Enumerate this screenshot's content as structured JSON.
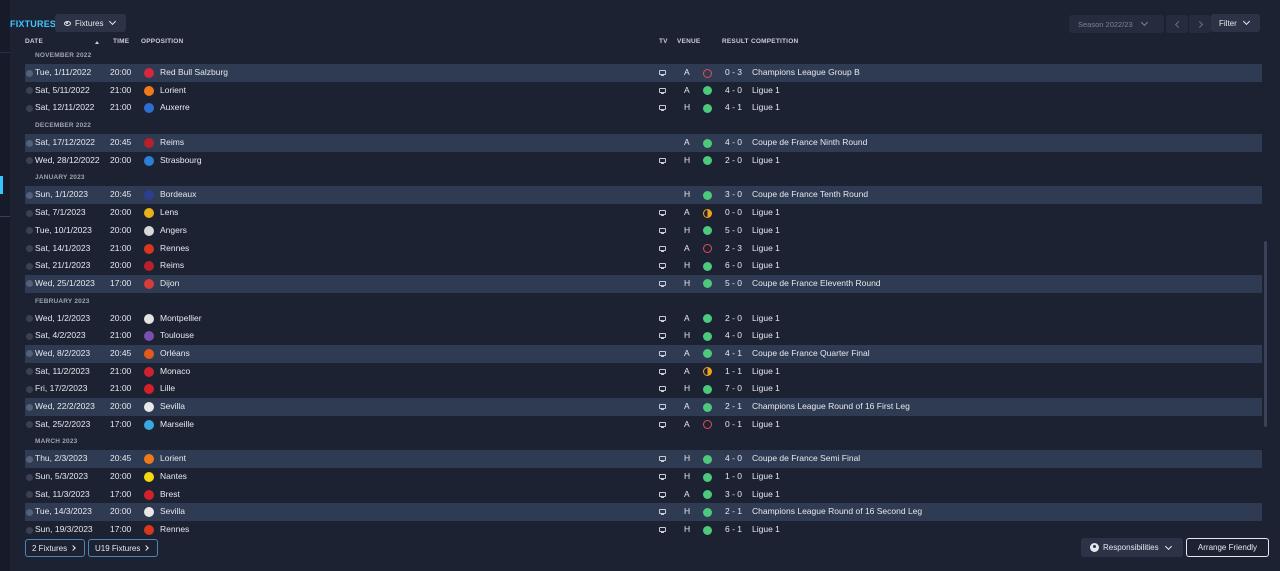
{
  "header": {
    "title": "FIXTURES",
    "view_dropdown": "Fixtures",
    "season": "Season 2022/23",
    "filter": "Filter"
  },
  "columns": {
    "date": "DATE",
    "time": "TIME",
    "opposition": "OPPOSITION",
    "tv": "TV",
    "venue": "VENUE",
    "result": "RESULT",
    "competition": "COMPETITION"
  },
  "months": [
    {
      "label": "NOVEMBER 2022",
      "fixtures": [
        {
          "date": "Tue, 1/11/2022",
          "time": "20:00",
          "opp": "Red Bull Salzburg",
          "badge": "#d7263d",
          "tv": true,
          "venue": "A",
          "outcome": "L",
          "result": "0 - 3",
          "comp": "Champions League Group B",
          "hl": true
        },
        {
          "date": "Sat, 5/11/2022",
          "time": "21:00",
          "opp": "Lorient",
          "badge": "#f07a1a",
          "tv": true,
          "venue": "A",
          "outcome": "W",
          "result": "4 - 0",
          "comp": "Ligue 1",
          "hl": false
        },
        {
          "date": "Sat, 12/11/2022",
          "time": "21:00",
          "opp": "Auxerre",
          "badge": "#2c6fd1",
          "tv": true,
          "venue": "H",
          "outcome": "W",
          "result": "4 - 1",
          "comp": "Ligue 1",
          "hl": false
        }
      ]
    },
    {
      "label": "DECEMBER 2022",
      "fixtures": [
        {
          "date": "Sat, 17/12/2022",
          "time": "20:45",
          "opp": "Reims",
          "badge": "#b8202c",
          "tv": false,
          "venue": "A",
          "outcome": "W",
          "result": "4 - 0",
          "comp": "Coupe de France Ninth Round",
          "hl": true
        },
        {
          "date": "Wed, 28/12/2022",
          "time": "20:00",
          "opp": "Strasbourg",
          "badge": "#2d7fd6",
          "tv": true,
          "venue": "H",
          "outcome": "W",
          "result": "2 - 0",
          "comp": "Ligue 1",
          "hl": false
        }
      ]
    },
    {
      "label": "JANUARY 2023",
      "fixtures": [
        {
          "date": "Sun, 1/1/2023",
          "time": "20:45",
          "opp": "Bordeaux",
          "badge": "#2a3f8f",
          "tv": false,
          "venue": "H",
          "outcome": "W",
          "result": "3 - 0",
          "comp": "Coupe de France Tenth Round",
          "hl": true
        },
        {
          "date": "Sat, 7/1/2023",
          "time": "20:00",
          "opp": "Lens",
          "badge": "#e6b21c",
          "tv": true,
          "venue": "A",
          "outcome": "D",
          "result": "0 - 0",
          "comp": "Ligue 1",
          "hl": false
        },
        {
          "date": "Tue, 10/1/2023",
          "time": "20:00",
          "opp": "Angers",
          "badge": "#d8d8d8",
          "tv": true,
          "venue": "H",
          "outcome": "W",
          "result": "5 - 0",
          "comp": "Ligue 1",
          "hl": false
        },
        {
          "date": "Sat, 14/1/2023",
          "time": "21:00",
          "opp": "Rennes",
          "badge": "#d9361f",
          "tv": true,
          "venue": "A",
          "outcome": "L",
          "result": "2 - 3",
          "comp": "Ligue 1",
          "hl": false
        },
        {
          "date": "Sat, 21/1/2023",
          "time": "20:00",
          "opp": "Reims",
          "badge": "#b8202c",
          "tv": true,
          "venue": "H",
          "outcome": "W",
          "result": "6 - 0",
          "comp": "Ligue 1",
          "hl": false
        },
        {
          "date": "Wed, 25/1/2023",
          "time": "17:00",
          "opp": "Dijon",
          "badge": "#d83b3b",
          "tv": true,
          "venue": "H",
          "outcome": "W",
          "result": "5 - 0",
          "comp": "Coupe de France Eleventh Round",
          "hl": true
        }
      ]
    },
    {
      "label": "FEBRUARY 2023",
      "fixtures": [
        {
          "date": "Wed, 1/2/2023",
          "time": "20:00",
          "opp": "Montpellier",
          "badge": "#e3e3e3",
          "tv": true,
          "venue": "A",
          "outcome": "W",
          "result": "2 - 0",
          "comp": "Ligue 1",
          "hl": false
        },
        {
          "date": "Sat, 4/2/2023",
          "time": "21:00",
          "opp": "Toulouse",
          "badge": "#7a4fb0",
          "tv": true,
          "venue": "H",
          "outcome": "W",
          "result": "4 - 0",
          "comp": "Ligue 1",
          "hl": false
        },
        {
          "date": "Wed, 8/2/2023",
          "time": "20:45",
          "opp": "Orléans",
          "badge": "#e35a1c",
          "tv": true,
          "venue": "A",
          "outcome": "W",
          "result": "4 - 1",
          "comp": "Coupe de France Quarter Final",
          "hl": true
        },
        {
          "date": "Sat, 11/2/2023",
          "time": "21:00",
          "opp": "Monaco",
          "badge": "#cf2030",
          "tv": true,
          "venue": "A",
          "outcome": "D",
          "result": "1 - 1",
          "comp": "Ligue 1",
          "hl": false
        },
        {
          "date": "Fri, 17/2/2023",
          "time": "21:00",
          "opp": "Lille",
          "badge": "#d4202a",
          "tv": true,
          "venue": "H",
          "outcome": "W",
          "result": "7 - 0",
          "comp": "Ligue 1",
          "hl": false
        },
        {
          "date": "Wed, 22/2/2023",
          "time": "20:00",
          "opp": "Sevilla",
          "badge": "#e8e8e8",
          "tv": true,
          "venue": "A",
          "outcome": "W",
          "result": "2 - 1",
          "comp": "Champions League Round of 16  First Leg",
          "hl": true
        },
        {
          "date": "Sat, 25/2/2023",
          "time": "17:00",
          "opp": "Marseille",
          "badge": "#39a8e0",
          "tv": true,
          "venue": "A",
          "outcome": "L",
          "result": "0 - 1",
          "comp": "Ligue 1",
          "hl": false
        }
      ]
    },
    {
      "label": "MARCH 2023",
      "fixtures": [
        {
          "date": "Thu, 2/3/2023",
          "time": "20:45",
          "opp": "Lorient",
          "badge": "#f07a1a",
          "tv": true,
          "venue": "H",
          "outcome": "W",
          "result": "4 - 0",
          "comp": "Coupe de France Semi Final",
          "hl": true
        },
        {
          "date": "Sun, 5/3/2023",
          "time": "20:00",
          "opp": "Nantes",
          "badge": "#f4d90f",
          "tv": true,
          "venue": "H",
          "outcome": "W",
          "result": "1 - 0",
          "comp": "Ligue 1",
          "hl": false
        },
        {
          "date": "Sat, 11/3/2023",
          "time": "17:00",
          "opp": "Brest",
          "badge": "#d4202a",
          "tv": true,
          "venue": "A",
          "outcome": "W",
          "result": "3 - 0",
          "comp": "Ligue 1",
          "hl": false
        },
        {
          "date": "Tue, 14/3/2023",
          "time": "20:00",
          "opp": "Sevilla",
          "badge": "#e8e8e8",
          "tv": true,
          "venue": "H",
          "outcome": "W",
          "result": "2 - 1",
          "comp": "Champions League Round of 16  Second Leg",
          "hl": true
        },
        {
          "date": "Sun, 19/3/2023",
          "time": "17:00",
          "opp": "Rennes",
          "badge": "#d9361f",
          "tv": true,
          "venue": "H",
          "outcome": "W",
          "result": "6 - 1",
          "comp": "Ligue 1",
          "hl": false
        }
      ]
    }
  ],
  "footer": {
    "fixtures_btn": "2 Fixtures",
    "u19_btn": "U19 Fixtures",
    "responsibilities": "Responsibilities",
    "arrange": "Arrange Friendly"
  },
  "colors": {
    "accent": "#3fc8ff",
    "win": "#4cc97a",
    "loss": "#e74c4c",
    "draw": "#f0a21e"
  }
}
